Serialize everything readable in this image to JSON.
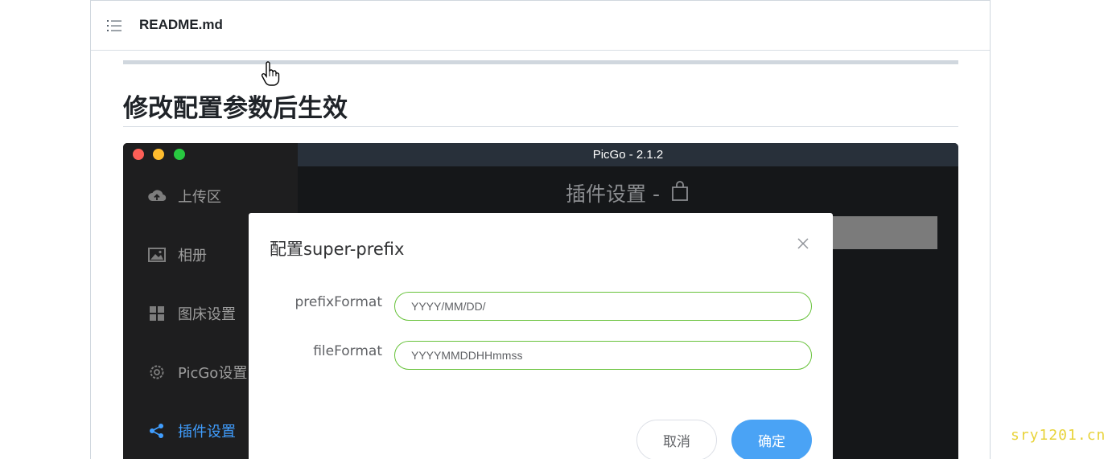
{
  "readme": {
    "filename": "README.md",
    "heading": "修改配置参数后生效"
  },
  "app": {
    "window_title": "PicGo - 2.1.2",
    "page_title": "插件设置 -",
    "sidebar": {
      "items": [
        {
          "label": "上传区",
          "icon": "cloud-upload-icon",
          "active": false
        },
        {
          "label": "相册",
          "icon": "image-icon",
          "active": false
        },
        {
          "label": "图床设置",
          "icon": "grid-icon",
          "active": false
        },
        {
          "label": "PicGo设置",
          "icon": "gear-icon",
          "active": false
        },
        {
          "label": "插件设置",
          "icon": "share-icon",
          "active": true
        }
      ]
    }
  },
  "dialog": {
    "title": "配置super-prefix",
    "fields": [
      {
        "label": "prefixFormat",
        "value": "YYYY/MM/DD/"
      },
      {
        "label": "fileFormat",
        "value": "YYYYMMDDHHmmss"
      }
    ],
    "cancel_label": "取消",
    "confirm_label": "确定"
  },
  "watermark": "sry1201.cn",
  "colors": {
    "active_accent": "#409eff",
    "input_border": "#67c23a",
    "confirm_button": "#4aa3f5",
    "traffic_red": "#fd5f57",
    "traffic_yellow": "#febc2e",
    "traffic_green": "#28c840"
  }
}
